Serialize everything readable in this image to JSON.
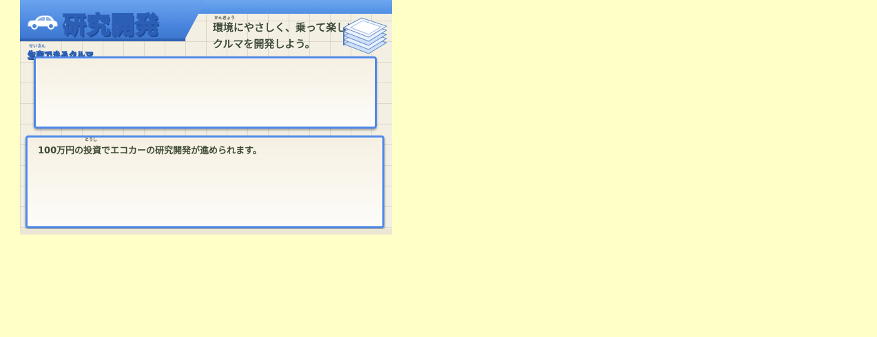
{
  "header": {
    "title": "研究開発",
    "description_line1": "環境にやさしく、乗って楽しい",
    "description_line2": "クルマを開発しよう。",
    "ruby_kankyou": "かんきょう"
  },
  "section": {
    "label": "生産できるクルマ",
    "ruby": "せいさん"
  },
  "info": {
    "text": "100万円の投資でエコカーの研究開発が進められます。",
    "ruby_toushi": "とうし"
  },
  "colors": {
    "page_background": "#ffffc8",
    "header_blue": "#4f8fe3",
    "panel_border": "#4f88e6",
    "text": "#3e4a35"
  },
  "icons": [
    "car-icon",
    "book-stack-icon"
  ]
}
